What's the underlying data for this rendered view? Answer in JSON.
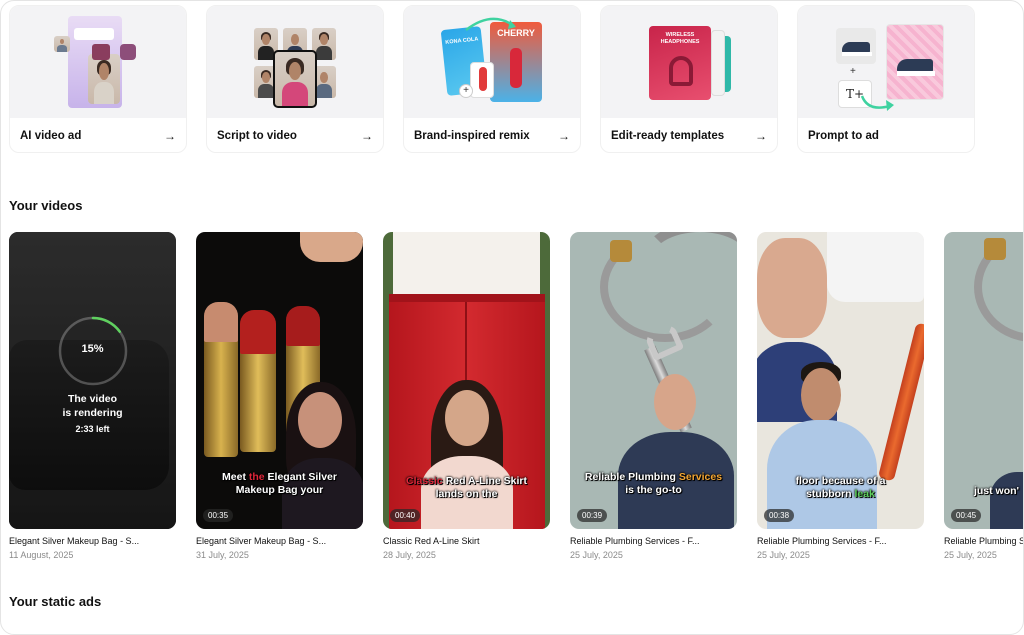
{
  "features": [
    {
      "label": "AI video ad",
      "arrow": "→"
    },
    {
      "label": "Script to video",
      "arrow": "→"
    },
    {
      "label": "Brand-inspired remix",
      "arrow": "→"
    },
    {
      "label": "Edit-ready templates",
      "arrow": "→"
    },
    {
      "label": "Prompt to ad",
      "arrow": ""
    }
  ],
  "feature_art": {
    "remix_left": "KONA COLA",
    "remix_right": "CHERRY",
    "template_title": "WIRELESS HEADPHONES"
  },
  "sections": {
    "videos_title": "Your videos",
    "static_title": "Your static ads"
  },
  "render_card": {
    "percent_text": "15%",
    "progress": 0.15,
    "message_line1": "The video",
    "message_line2": "is rendering",
    "time_left": "2:33 left"
  },
  "videos": [
    {
      "title": "Elegant Silver Makeup Bag - S...",
      "date": "11 August, 2025",
      "duration": ""
    },
    {
      "title": "Elegant Silver Makeup Bag - S...",
      "date": "31 July, 2025",
      "duration": "00:35",
      "caption_pre": "Meet ",
      "caption_hl": "the",
      "caption_post": " Elegant Silver",
      "caption_line2": "Makeup Bag your"
    },
    {
      "title": "Classic Red A-Line Skirt",
      "date": "28 July, 2025",
      "duration": "00:40",
      "caption_hl": "Classic",
      "caption_post": " Red A-Line Skirt",
      "caption_line2": "lands on the"
    },
    {
      "title": "Reliable Plumbing Services - F...",
      "date": "25 July, 2025",
      "duration": "00:39",
      "caption_pre": "Reliable Plumbing ",
      "caption_hl": "Services",
      "caption_line2": "is the go-to"
    },
    {
      "title": "Reliable Plumbing Services - F...",
      "date": "25 July, 2025",
      "duration": "00:38",
      "caption_pre": "floor because of a",
      "caption_line2_pre": "stubborn ",
      "caption_hl": "leak"
    },
    {
      "title": "Reliable Plumbing S",
      "date": "25 July, 2025",
      "duration": "00:45",
      "caption_pre": "just won'"
    }
  ],
  "colors": {
    "accent_red": "#e0263a",
    "accent_orange": "#f2a533",
    "accent_green": "#5fd15f",
    "render_ring": "#5fd15f"
  }
}
